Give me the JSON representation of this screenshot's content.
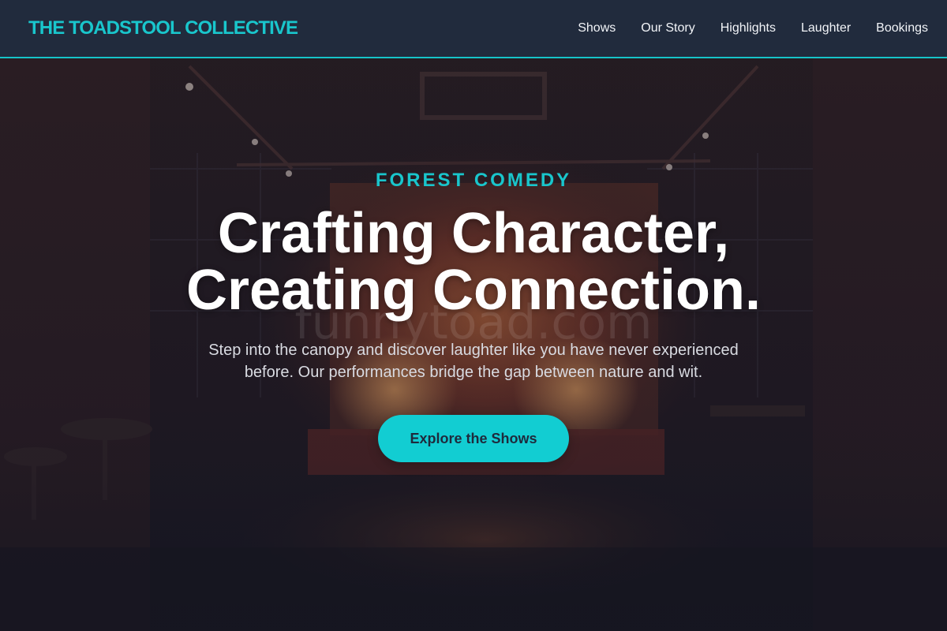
{
  "brand": {
    "name": "THE TOADSTOOL COLLECTIVE"
  },
  "nav": {
    "items": [
      {
        "label": "Shows"
      },
      {
        "label": "Our Story"
      },
      {
        "label": "Highlights"
      },
      {
        "label": "Laughter"
      },
      {
        "label": "Bookings"
      }
    ]
  },
  "hero": {
    "eyebrow": "FOREST COMEDY",
    "title_line1": "Crafting Character,",
    "title_line2": "Creating Connection.",
    "description": "Step into the canopy and discover laughter like you have never experienced before. Our performances bridge the gap between nature and wit.",
    "cta_label": "Explore the Shows",
    "watermark": "funnytoad.com"
  },
  "colors": {
    "accent": "#19c6cc",
    "header_bg": "#212b3d",
    "button_bg": "#12cdd2",
    "button_text": "#1f2a3c"
  }
}
